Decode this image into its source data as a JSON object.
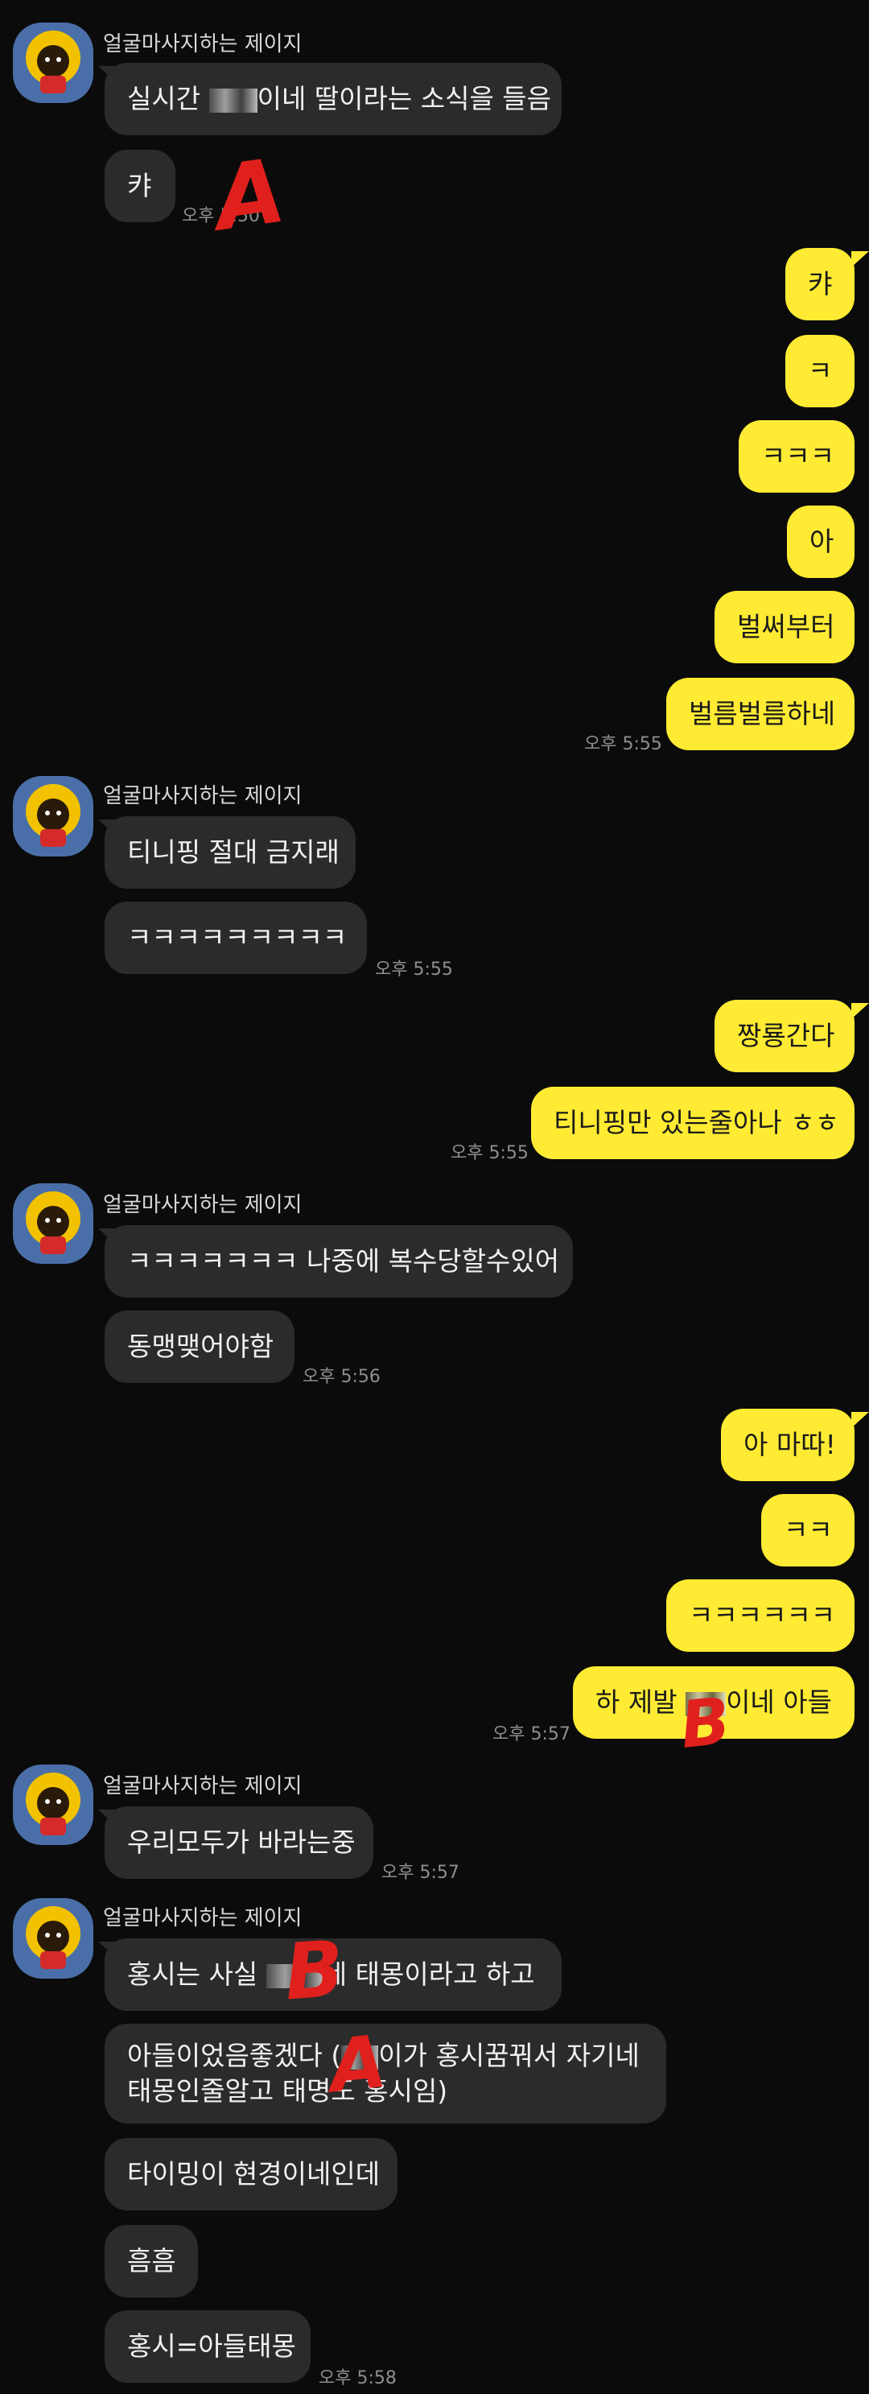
{
  "sender_name": "얼굴마사지하는 제이지",
  "annotations": [
    "A",
    "B",
    "B",
    "A"
  ],
  "messages": {
    "g1_m1a": "실시간 ",
    "g1_m1b": "이네 딸이라는 소식을 들음",
    "g1_m2": "캬",
    "g1_time": "오후 5:50",
    "s1_m1": "캬",
    "s1_m2": "ㅋ",
    "s1_m3": "ㅋㅋㅋ",
    "s1_m4": "아",
    "s1_m5": "벌써부터",
    "s1_m6": "벌름벌름하네",
    "s1_time": "오후 5:55",
    "g2_m1": "티니핑 절대 금지래",
    "g2_m2": "ㅋㅋㅋㅋㅋㅋㅋㅋㅋ",
    "g2_time": "오후 5:55",
    "s2_m1": "짱룡간다",
    "s2_m2": "티니핑만 있는줄아나 ㅎㅎ",
    "s2_time": "오후 5:55",
    "g3_m1": "ㅋㅋㅋㅋㅋㅋㅋ 나중에 복수당할수있어",
    "g3_m2": "동맹맺어야함",
    "g3_time": "오후 5:56",
    "s3_m1": "아 마따!",
    "s3_m2": "ㅋㅋ",
    "s3_m3": "ㅋㅋㅋㅋㅋㅋ",
    "s3_m4a": "하 제발 ",
    "s3_m4b": "이네 아들",
    "s3_time": "오후 5:57",
    "g4_m1": "우리모두가 바라는중",
    "g4_time": "오후 5:57",
    "g5_m1a": "홍시는 사실 ",
    "g5_m1b": "네 태몽이라고 하고",
    "g5_m2a": "아들이었음좋겠다 (",
    "g5_m2b": "이가 홍시꿈꿔서 자기네 태몽인줄알고 태명도 홍시임)",
    "g5_m3": "타이밍이 현경이네인데",
    "g5_m4": "흠흠",
    "g5_m5": "홍시=아들태몽",
    "g5_time": "오후 5:58"
  },
  "colors": {
    "background": "#0b0b0b",
    "received": "#2b2b2b",
    "sent": "#ffeb33"
  }
}
